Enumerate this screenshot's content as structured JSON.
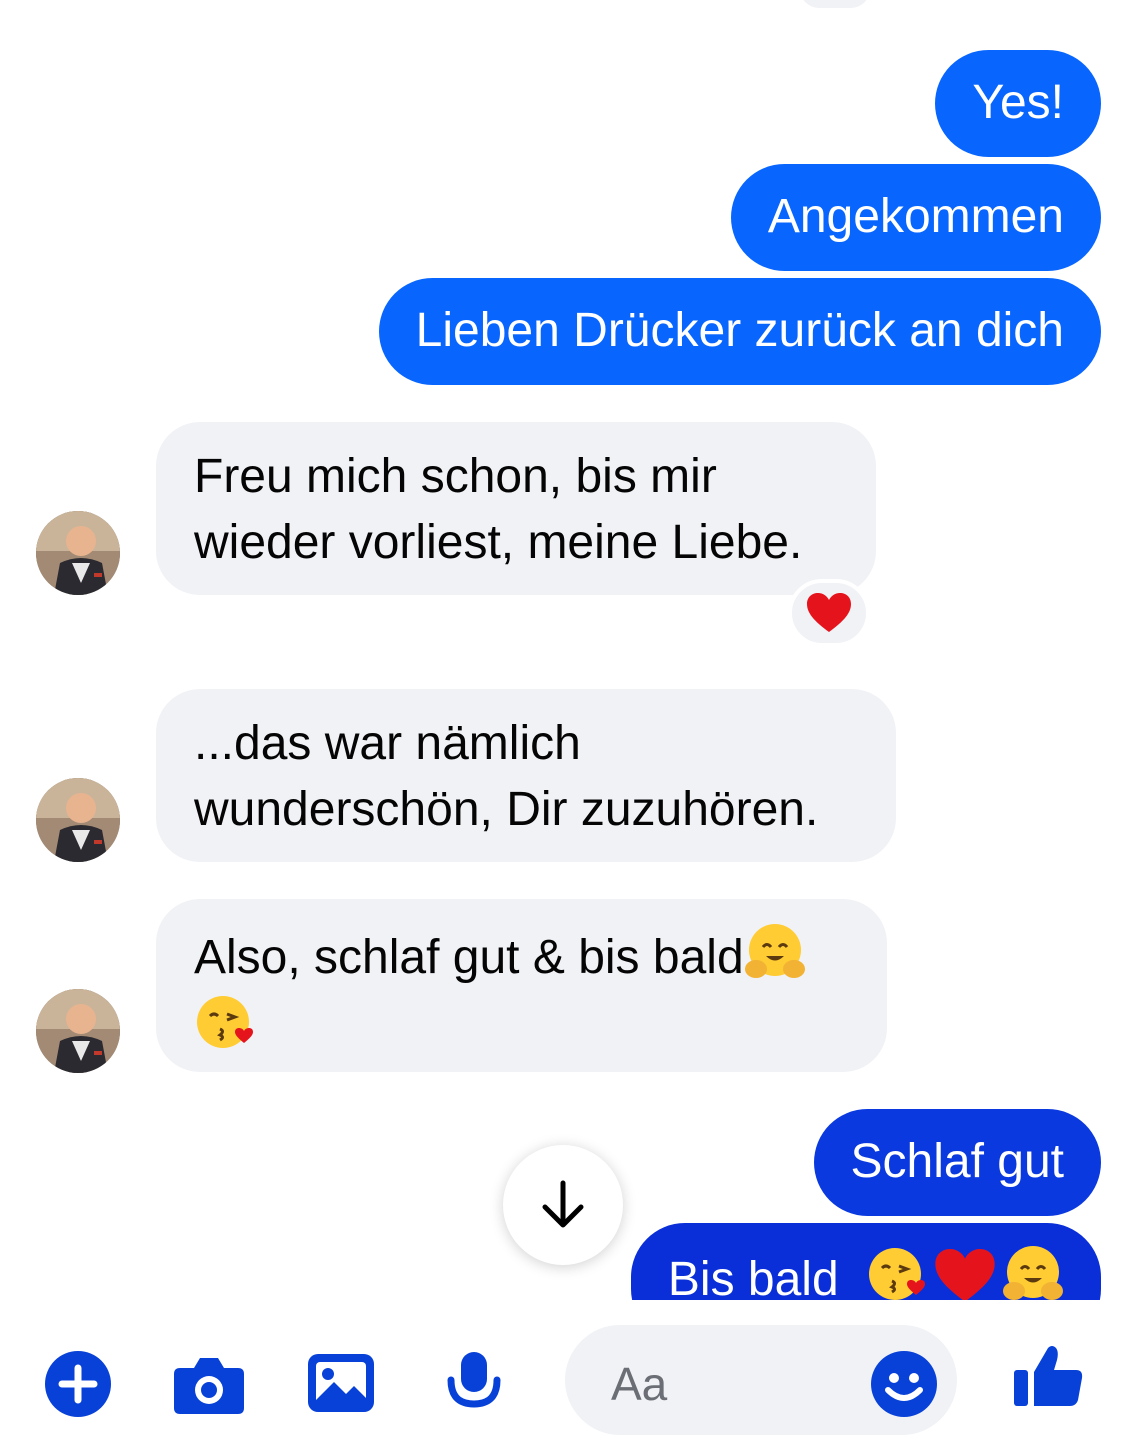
{
  "conversation": {
    "messages": [
      {
        "direction": "outgoing",
        "text": "Yes!"
      },
      {
        "direction": "outgoing",
        "text": "Angekommen"
      },
      {
        "direction": "outgoing",
        "text": "Lieben Drücker zurück an dich"
      },
      {
        "direction": "incoming",
        "line1": "Freu mich schon, bis mir",
        "line2": "wieder vorliest, meine Liebe.",
        "reaction": "heart"
      },
      {
        "direction": "incoming",
        "line1": "...das war nämlich",
        "line2": "wunderschön, Dir zuzuhören."
      },
      {
        "direction": "incoming",
        "line1": "Also, schlaf gut & bis bald",
        "emojis": [
          "hugging-face",
          "face-blowing-kiss"
        ]
      },
      {
        "direction": "outgoing",
        "text": "Schlaf gut"
      },
      {
        "direction": "outgoing",
        "text": "Bis bald",
        "emojis": [
          "face-blowing-kiss",
          "heart",
          "hugging-face"
        ]
      }
    ]
  },
  "composer": {
    "placeholder": "Aa",
    "icons": [
      "plus-icon",
      "camera-icon",
      "image-icon",
      "microphone-icon",
      "emoji-icon",
      "thumbs-up-icon"
    ]
  },
  "colors": {
    "outgoing_bubble": "#0866ff",
    "outgoing_bubble_dark": "#0a2fd8",
    "incoming_bubble": "#f1f2f6",
    "accent": "#0841d8"
  }
}
